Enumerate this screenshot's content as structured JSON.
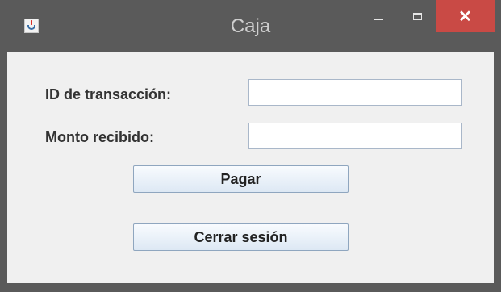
{
  "window": {
    "title": "Caja",
    "close_glyph": "✕",
    "icon": "java-cup-icon"
  },
  "form": {
    "transaction_label": "ID de transacción:",
    "transaction_value": "",
    "amount_label": "Monto recibido:",
    "amount_value": "",
    "pay_button": "Pagar",
    "logout_button": "Cerrar sesión"
  },
  "colors": {
    "titlebar": "#5a5a5a",
    "close_button": "#c94a45",
    "panel": "#f0f0f0"
  }
}
